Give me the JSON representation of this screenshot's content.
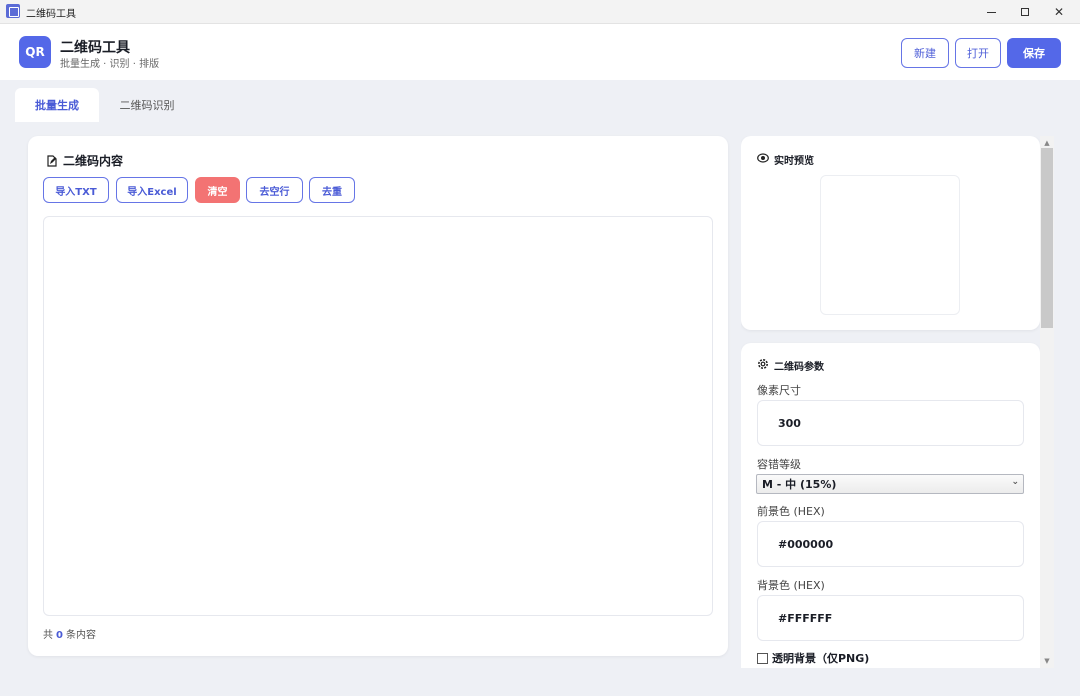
{
  "window": {
    "title": "二维码工具",
    "controls": [
      "minimize-icon",
      "maximize-icon",
      "close-icon"
    ]
  },
  "header": {
    "logo_text": "QR",
    "title": "二维码工具",
    "subtitle": "批量生成 · 识别 · 排版",
    "buttons": {
      "new": "新建",
      "open": "打开",
      "save": "保存"
    }
  },
  "tabs": [
    {
      "label": "批量生成",
      "active": true
    },
    {
      "label": "二维码识别",
      "active": false
    }
  ],
  "content_panel": {
    "title": "二维码内容",
    "icon": "edit-icon",
    "toolbar": {
      "import_txt": "导入TXT",
      "import_excel": "导入Excel",
      "clear": "清空",
      "remove_blank": "去空行",
      "dedupe": "去重"
    },
    "textarea_value": "",
    "count_prefix": "共",
    "count_value": "0",
    "count_suffix": "条内容"
  },
  "preview_panel": {
    "title": "实时预览",
    "icon": "eye-icon"
  },
  "params_panel": {
    "title": "二维码参数",
    "icon": "gear-icon",
    "size_label": "像素尺寸",
    "size_value": "300",
    "ecc_label": "容错等级",
    "ecc_value": "M - 中 (15%)",
    "fg_label": "前景色 (HEX)",
    "fg_value": "#000000",
    "bg_label": "背景色 (HEX)",
    "bg_value": "#FFFFFF",
    "transparent_label": "透明背景（仅PNG)",
    "transparent_checked": false
  },
  "colors": {
    "accent": "#5468e8",
    "danger": "#f37373",
    "background": "#eef0f5"
  }
}
